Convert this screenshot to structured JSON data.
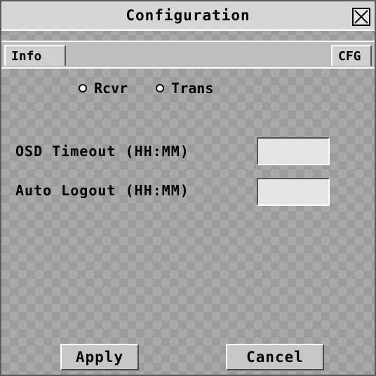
{
  "window": {
    "title": "Configuration"
  },
  "tabs": [
    {
      "label": "Info"
    },
    {
      "label": "CFG"
    }
  ],
  "mode": {
    "options": [
      {
        "label": "Rcvr",
        "selected": false
      },
      {
        "label": "Trans",
        "selected": false
      }
    ]
  },
  "fields": {
    "osd_timeout": {
      "label": "OSD Timeout (HH:MM)",
      "value": ""
    },
    "auto_logout": {
      "label": "Auto Logout (HH:MM)",
      "value": ""
    }
  },
  "buttons": {
    "apply": "Apply",
    "cancel": "Cancel"
  },
  "icons": {
    "close": "close-icon"
  }
}
